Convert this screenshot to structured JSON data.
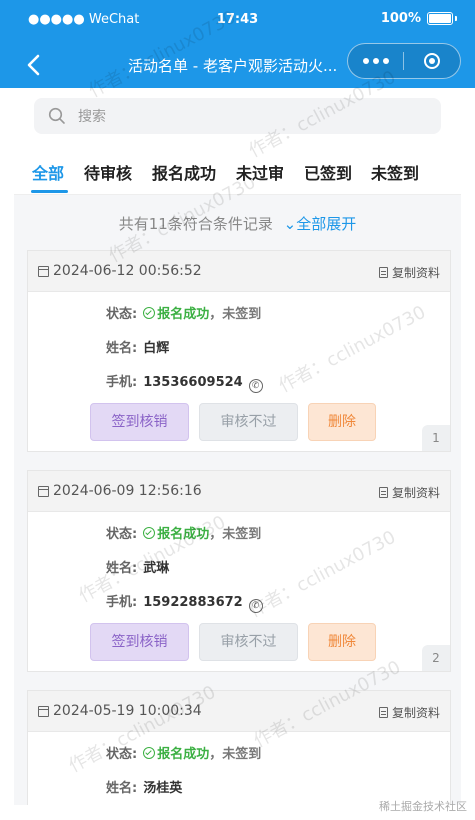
{
  "status_bar": {
    "carrier": "●●●●● WeChat",
    "time": "17:43",
    "battery": "100%"
  },
  "nav": {
    "title": "活动名单 - 老客户观影活动火..."
  },
  "search": {
    "placeholder": "搜索"
  },
  "tabs": [
    {
      "label": "全部",
      "active": true
    },
    {
      "label": "待审核"
    },
    {
      "label": "报名成功"
    },
    {
      "label": "未过审"
    },
    {
      "label": "已签到"
    },
    {
      "label": "未签到"
    }
  ],
  "summary": {
    "text": "共有11条符合条件记录",
    "expand": "全部展开"
  },
  "labels": {
    "status": "状态:",
    "name": "姓名:",
    "phone": "手机:",
    "copy": "复制资料",
    "verify": "签到核销",
    "reject": "审核不过",
    "delete": "删除"
  },
  "records": [
    {
      "date": "2024-06-12 00:56:52",
      "status": "报名成功",
      "sign": "未签到",
      "name": "白辉",
      "phone": "13536609524",
      "index": "1"
    },
    {
      "date": "2024-06-09 12:56:16",
      "status": "报名成功",
      "sign": "未签到",
      "name": "武琳",
      "phone": "15922883672",
      "index": "2"
    },
    {
      "date": "2024-05-19 10:00:34",
      "status": "报名成功",
      "sign": "未签到",
      "name": "汤桂英"
    }
  ],
  "watermark": "作者：cclinux0730",
  "footer": "稀土掘金技术社区",
  "colors": {
    "primary": "#1d97e8",
    "success": "#3cb043"
  }
}
